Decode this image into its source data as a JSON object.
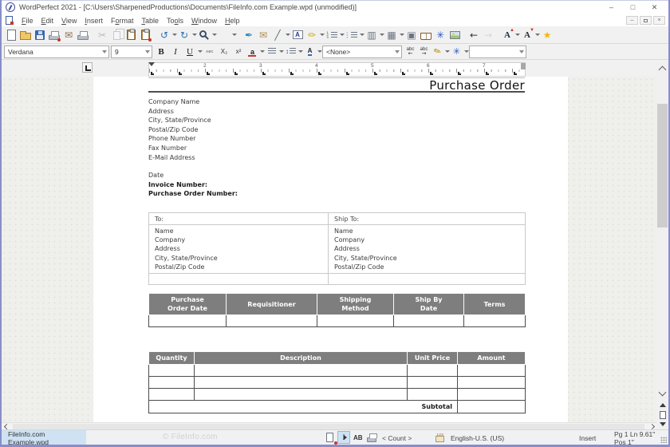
{
  "window": {
    "title": "WordPerfect 2021 - [C:\\Users\\SharpenedProductions\\Documents\\FileInfo.com Example.wpd (unmodified)]",
    "controls": {
      "minimize": "–",
      "maximize": "□",
      "close": "✕"
    },
    "mdi_controls": {
      "minimize": "–",
      "close": "×"
    }
  },
  "menu": {
    "items": [
      {
        "label": "File",
        "accel": 0
      },
      {
        "label": "Edit",
        "accel": 0
      },
      {
        "label": "View",
        "accel": 0
      },
      {
        "label": "Insert",
        "accel": 0
      },
      {
        "label": "Format",
        "accel": 1
      },
      {
        "label": "Table",
        "accel": 0
      },
      {
        "label": "Tools",
        "accel": 2
      },
      {
        "label": "Window",
        "accel": 0
      },
      {
        "label": "Help",
        "accel": 0
      }
    ]
  },
  "toolbar": {
    "icons": [
      {
        "name": "new-blank-document",
        "kind": "page"
      },
      {
        "name": "open",
        "kind": "folder"
      },
      {
        "name": "save",
        "kind": "floppy"
      },
      {
        "name": "print-file",
        "kind": "printer",
        "accent": "#c0392b"
      },
      {
        "name": "print-envelope",
        "kind": "glyph",
        "glyph": "✉",
        "color": "#8d6e4a"
      },
      {
        "name": "print",
        "kind": "printer"
      },
      {
        "name": "cut",
        "kind": "glyph",
        "glyph": "✂",
        "color": "#5a6b7a",
        "disabled": true,
        "sep_before": true
      },
      {
        "name": "copy",
        "kind": "copy",
        "disabled": true
      },
      {
        "name": "paste",
        "kind": "clip"
      },
      {
        "name": "paste-unformatted",
        "kind": "clip",
        "accent": "#c0392b"
      },
      {
        "name": "undo",
        "kind": "glyph",
        "glyph": "↺",
        "color": "#2e6db4",
        "dropdown": true,
        "sep_before": true
      },
      {
        "name": "redo",
        "kind": "glyph",
        "glyph": "↻",
        "color": "#2e6db4",
        "dropdown": true
      },
      {
        "name": "zoom",
        "kind": "zoom",
        "dropdown": true
      },
      {
        "name": "insert-date",
        "kind": "calendar",
        "dropdown": true
      },
      {
        "name": "proofread-pen",
        "kind": "glyph",
        "glyph": "✒",
        "color": "#2e86c1",
        "sep_before": true
      },
      {
        "name": "mail",
        "kind": "glyph",
        "glyph": "✉",
        "color": "#b08950"
      },
      {
        "name": "draw-line",
        "kind": "glyph",
        "glyph": "╱",
        "color": "#5a6b7a",
        "dropdown": true
      },
      {
        "name": "text-box",
        "kind": "tbox"
      },
      {
        "name": "highlight",
        "kind": "glyph",
        "glyph": "✏",
        "color": "#d4ac0d",
        "dropdown": true
      },
      {
        "name": "numbered-list",
        "kind": "listnum",
        "dropdown": true
      },
      {
        "name": "bullet-list",
        "kind": "listbul",
        "dropdown": true
      },
      {
        "name": "columns",
        "kind": "glyph",
        "glyph": "▥",
        "color": "#6b7280",
        "dropdown": true
      },
      {
        "name": "table",
        "kind": "glyph",
        "glyph": "▦",
        "color": "#6b7280",
        "dropdown": true
      },
      {
        "name": "graphics-frame",
        "kind": "glyph",
        "glyph": "▣",
        "color": "#6b7280"
      },
      {
        "name": "reference-book",
        "kind": "book"
      },
      {
        "name": "quickart",
        "kind": "glyph",
        "glyph": "✳",
        "color": "#2457c5"
      },
      {
        "name": "scrapbook",
        "kind": "img"
      },
      {
        "name": "go-back",
        "kind": "glyph",
        "glyph": "←",
        "color": "#333333",
        "sep_before": true
      },
      {
        "name": "go-forward",
        "kind": "glyph",
        "glyph": "→",
        "color": "#aaaaaa",
        "disabled": true
      },
      {
        "name": "font-size-up",
        "kind": "fontup",
        "dropdown": true,
        "sep_before": true
      },
      {
        "name": "font-size-down",
        "kind": "fontdown",
        "dropdown": true
      },
      {
        "name": "favorites",
        "kind": "glyph",
        "glyph": "★",
        "color": "#f1b70e"
      }
    ]
  },
  "property_bar": {
    "items": [
      {
        "type": "combo",
        "name": "font-face-combo",
        "value": "Verdana",
        "width": 132
      },
      {
        "type": "combo",
        "name": "font-size-combo",
        "value": "9",
        "width": 52
      },
      {
        "type": "btn",
        "name": "bold-button",
        "label": "B",
        "cls": "b-bold"
      },
      {
        "type": "btn",
        "name": "italic-button",
        "label": "I",
        "cls": "b-italic"
      },
      {
        "type": "btn",
        "name": "underline-button",
        "label": "U",
        "cls": "b-underline",
        "dropdown": true
      },
      {
        "type": "btn",
        "name": "redline-button",
        "label": "ᴀʙᴄ",
        "cls": "b-small"
      },
      {
        "type": "btn",
        "name": "subscript-button",
        "label": "X₂",
        "cls": "b-small2"
      },
      {
        "type": "btn",
        "name": "superscript-button",
        "label": "x²",
        "cls": "b-small2"
      },
      {
        "type": "icon",
        "name": "font-color-button",
        "kind": "fontcolor",
        "glyph": "a",
        "dropdown": true
      },
      {
        "type": "icon",
        "name": "justification-button",
        "kind": "just",
        "dropdown": true
      },
      {
        "type": "icon",
        "name": "line-spacing-button",
        "kind": "lsp",
        "glyph": "↕",
        "dropdown": true
      },
      {
        "type": "icon",
        "name": "font-attributes-button",
        "kind": "fattr",
        "glyph": "A",
        "dropdown": true
      },
      {
        "type": "combo",
        "name": "style-combo",
        "value": "<None>",
        "width": 100
      },
      {
        "type": "icon",
        "name": "previous-word-button",
        "kind": "abc",
        "glyph": "abc",
        "arrow": "←"
      },
      {
        "type": "icon",
        "name": "next-word-button",
        "kind": "abc",
        "glyph": "abc",
        "arrow": "→"
      },
      {
        "type": "icon",
        "name": "quickwords-button",
        "kind": "qw",
        "glyph": "✎",
        "dropdown": true
      },
      {
        "type": "icon",
        "name": "symbols-button",
        "kind": "sym",
        "glyph": "✳",
        "dropdown": true
      },
      {
        "type": "combo",
        "name": "selection-style-combo",
        "value": "",
        "width": 72
      }
    ]
  },
  "ruler": {
    "numbers": [
      "2",
      "3",
      "4",
      "5",
      "6",
      "7"
    ]
  },
  "document": {
    "title": "Purchase Order",
    "company_block": [
      "Company Name",
      "Address",
      "City, State/Province",
      "Postal/Zip Code",
      "Phone Number",
      "Fax Number",
      "E-Mail Address"
    ],
    "meta": [
      {
        "text": "Date",
        "bold": false
      },
      {
        "text": "Invoice Number:",
        "bold": true
      },
      {
        "text": "Purchase Order Number:",
        "bold": true
      }
    ],
    "to_table": {
      "headers": [
        "To:",
        "Ship To:"
      ],
      "lines": [
        "Name",
        "Company",
        "Address",
        "City, State/Province",
        "Postal/Zip Code"
      ]
    },
    "po_table": {
      "headers": [
        "Purchase\nOrder Date",
        "Requisitioner",
        "Shipping\nMethod",
        "Ship By\nDate",
        "Terms"
      ],
      "widths": [
        97,
        114,
        96,
        88,
        77
      ]
    },
    "items_table": {
      "headers": [
        "Quantity",
        "Description",
        "Unit Price",
        "Amount"
      ],
      "widths": [
        57,
        267,
        63,
        85
      ],
      "empty_rows": 3,
      "subtotal_label": "Subtotal"
    }
  },
  "status_bar": {
    "tab_label": "FileInfo.com Example.wpd",
    "watermark": "© FileInfo.com",
    "caps_indicator": "AB",
    "count_label": "< Count >",
    "language": "English-U.S. (US)",
    "mode": "Insert",
    "position": "Pg 1 Ln 9.61\" Pos 1\""
  }
}
